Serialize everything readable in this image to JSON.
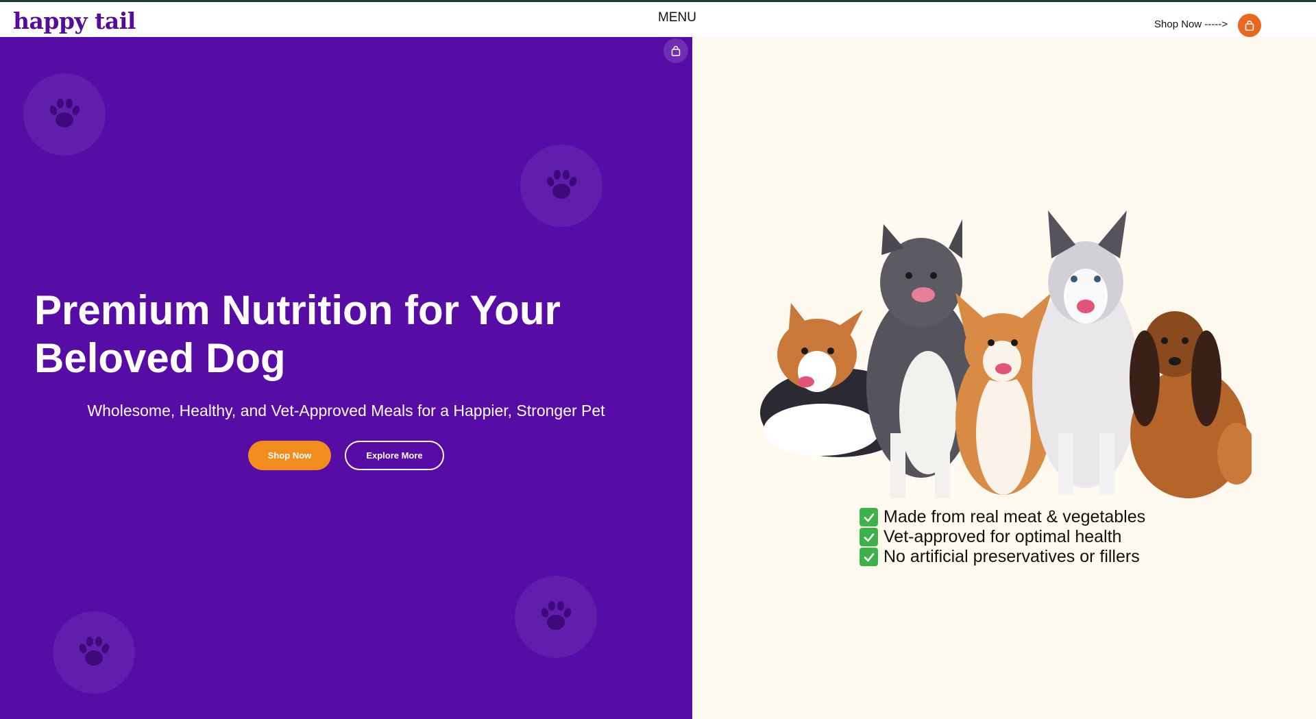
{
  "header": {
    "logo": "happy tail",
    "menu_label": "MENU",
    "shop_now_link": "Shop Now ----->",
    "cart_icon": "shopping-bag-icon"
  },
  "hero": {
    "headline": "Premium Nutrition for Your Beloved Dog",
    "subheadline": "Wholesome, Healthy, and Vet-Approved Meals for a Happier, Stronger Pet",
    "primary_button": "Shop Now",
    "secondary_button": "Explore More",
    "background_color": "#560ca5",
    "primary_button_color": "#f28c1c",
    "decor_icon": "paw-print-icon"
  },
  "side": {
    "image": "group-of-dogs",
    "features": [
      "Made from real meat & vegetables",
      "Vet-approved for optimal health",
      "No artificial preservatives or fillers"
    ],
    "feature_icon": "check-mark-icon",
    "background_color": "#fffaef"
  }
}
